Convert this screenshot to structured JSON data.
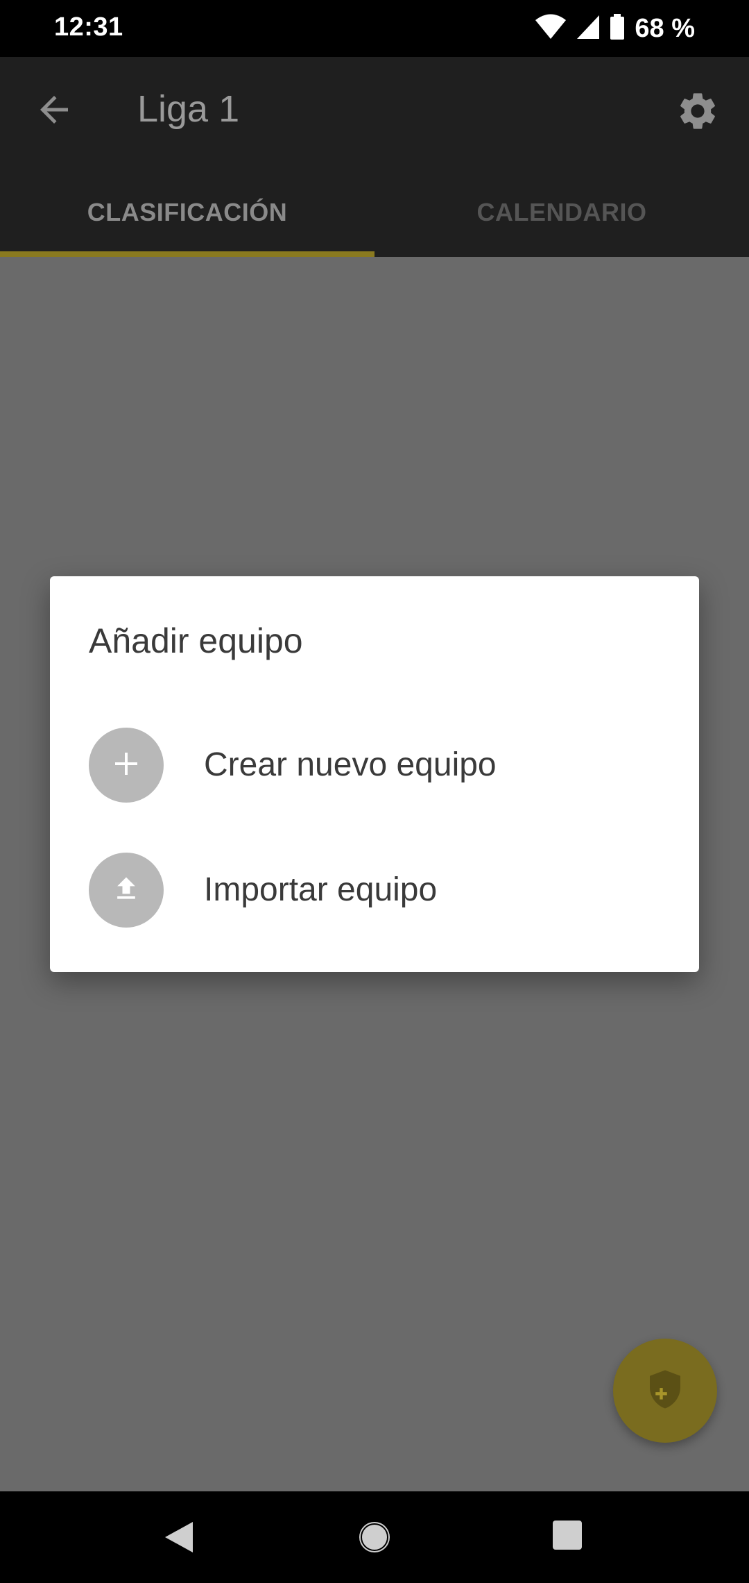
{
  "status_bar": {
    "time": "12:31",
    "battery": "68 %",
    "icons": [
      "wifi-icon",
      "signal-icon",
      "battery-icon"
    ]
  },
  "app_bar": {
    "title": "Liga 1",
    "back_icon": "arrow-back-icon",
    "settings_icon": "gear-icon"
  },
  "tabs": [
    {
      "label": "CLASIFICACIÓN",
      "selected": true
    },
    {
      "label": "CALENDARIO",
      "selected": false
    }
  ],
  "dialog": {
    "title": "Añadir equipo",
    "items": [
      {
        "label": "Crear nuevo equipo",
        "icon": "plus-icon"
      },
      {
        "label": "Importar equipo",
        "icon": "upload-icon"
      }
    ]
  },
  "fab": {
    "icon": "shield-plus-icon"
  },
  "colors": {
    "accent": "#c9b32e",
    "accent_dimmed": "#7a6c1f",
    "app_bar": "#1f1f1f",
    "scrim_content": "#6a6a6a",
    "dialog_bg": "#ffffff"
  },
  "nav_bar": {
    "icons": [
      "nav-back-icon",
      "nav-home-icon",
      "nav-recents-icon"
    ]
  }
}
